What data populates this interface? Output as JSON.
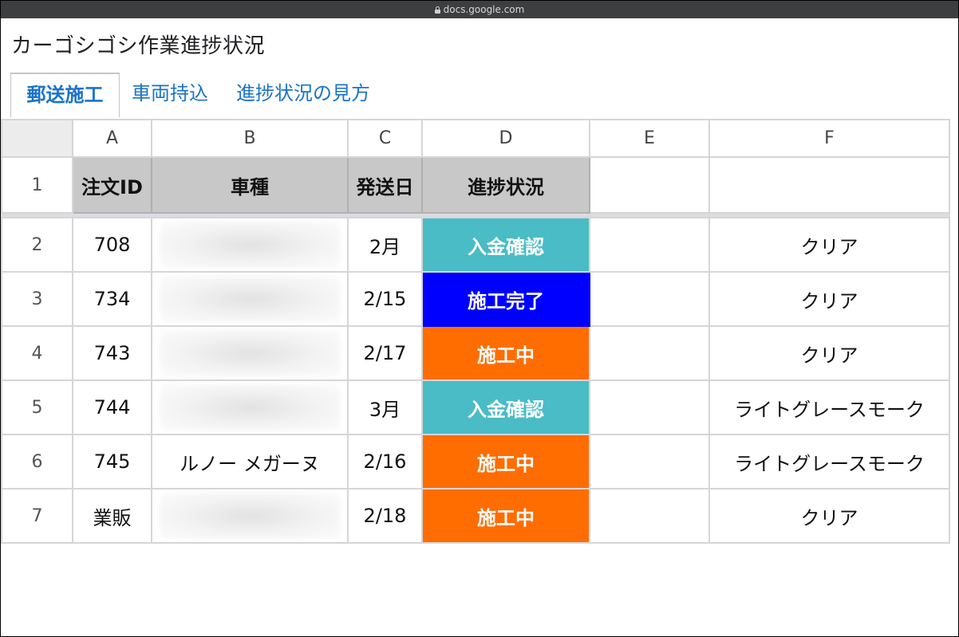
{
  "browser": {
    "url": "docs.google.com"
  },
  "document": {
    "title": "カーゴシゴシ作業進捗状況"
  },
  "tabs": [
    {
      "label": "郵送施工",
      "active": true
    },
    {
      "label": "車両持込",
      "active": false
    },
    {
      "label": "進捗状況の見方",
      "active": false
    }
  ],
  "columns": [
    "A",
    "B",
    "C",
    "D",
    "E",
    "F"
  ],
  "header_row": {
    "num": "1",
    "cells": [
      "注文ID",
      "車種",
      "発送日",
      "進捗状況",
      "",
      ""
    ]
  },
  "rows": [
    {
      "num": "2",
      "id": "708",
      "car": "",
      "date": "2月",
      "status": "入金確認",
      "status_color": "#49bcc6",
      "e": "",
      "f": "クリア"
    },
    {
      "num": "3",
      "id": "734",
      "car": "",
      "date": "2/15",
      "status": "施工完了",
      "status_color": "#0000ff",
      "e": "",
      "f": "クリア"
    },
    {
      "num": "4",
      "id": "743",
      "car": "",
      "date": "2/17",
      "status": "施工中",
      "status_color": "#ff6d01",
      "e": "",
      "f": "クリア"
    },
    {
      "num": "5",
      "id": "744",
      "car": "",
      "date": "3月",
      "status": "入金確認",
      "status_color": "#49bcc6",
      "e": "",
      "f": "ライトグレースモーク"
    },
    {
      "num": "6",
      "id": "745",
      "car": "ルノー メガーヌ",
      "date": "2/16",
      "status": "施工中",
      "status_color": "#ff6d01",
      "e": "",
      "f": "ライトグレースモーク"
    },
    {
      "num": "7",
      "id": "業販",
      "car": "",
      "date": "2/18",
      "status": "施工中",
      "status_color": "#ff6d01",
      "e": "",
      "f": "クリア"
    }
  ]
}
